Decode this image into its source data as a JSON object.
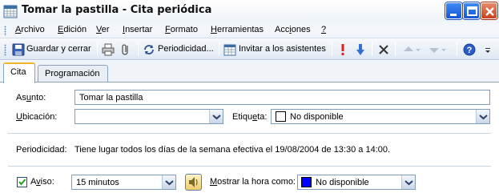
{
  "window": {
    "title": "Tomar la pastilla - Cita periódica",
    "minimize": "minimize",
    "maximize": "maximize",
    "close": "close"
  },
  "menu": [
    {
      "pre": "",
      "u": "A",
      "post": "rchivo"
    },
    {
      "pre": "",
      "u": "E",
      "post": "dición"
    },
    {
      "pre": "",
      "u": "V",
      "post": "er"
    },
    {
      "pre": "",
      "u": "I",
      "post": "nsertar"
    },
    {
      "pre": "",
      "u": "F",
      "post": "ormato"
    },
    {
      "pre": "",
      "u": "H",
      "post": "erramientas"
    },
    {
      "pre": "Acc",
      "u": "i",
      "post": "ones"
    },
    {
      "pre": "",
      "u": "?",
      "post": ""
    }
  ],
  "toolbar": {
    "save_close": "Guardar y cerrar",
    "recurrence": "Periodicidad...",
    "invite": "Invitar a los asistentes"
  },
  "tabs": {
    "cita": "Cita",
    "programacion": "Programación"
  },
  "form": {
    "subject_label": "Asunto:",
    "subject_value": "Tomar la pastilla",
    "location_label": "Ubicación:",
    "location_value": "",
    "label_label": "Etiqueta:",
    "label_value": "No disponible",
    "recurrence_label": "Periodicidad:",
    "recurrence_text": "Tiene lugar todos los días de la semana efectiva el 19/08/2004 de 13:30 a 14:00.",
    "reminder_label": "Aviso:",
    "reminder_checked": true,
    "reminder_value": "15 minutos",
    "showas_label": "Mostrar la hora como:",
    "showas_value": "No disponible",
    "showas_color": "#0000ff"
  },
  "colors": {
    "accent": "#f0b62b",
    "border": "#7f9db9"
  }
}
